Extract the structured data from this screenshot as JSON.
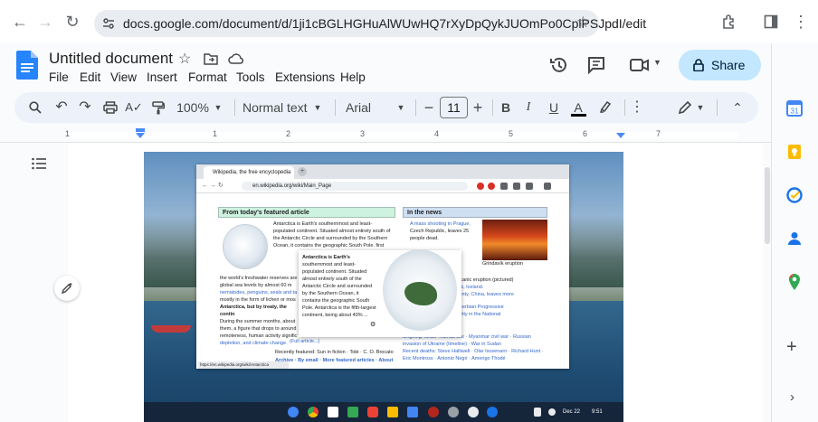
{
  "browser": {
    "url": "docs.google.com/document/d/1ji1cBGLHGHuAlWUwHQ7rXyDpQykJUOmPo0CplPSJpdI/edit"
  },
  "doc": {
    "title": "Untitled document",
    "menu": [
      "File",
      "Edit",
      "View",
      "Insert",
      "Format",
      "Tools",
      "Extensions",
      "Help"
    ],
    "share_label": "Share"
  },
  "toolbar": {
    "zoom": "100%",
    "style": "Normal text",
    "font": "Arial",
    "font_size": "11"
  },
  "ruler": {
    "labels": [
      "1",
      "1",
      "2",
      "3",
      "4",
      "5",
      "6",
      "7"
    ]
  },
  "embedded_screenshot": {
    "tab_title": "Wikipedia, the free encyclopedia",
    "address": "en.wikipedia.org/wiki/Main_Page",
    "featured_heading": "From today's featured article",
    "news_heading": "In the news",
    "featured_lines": [
      "Antarctica is Earth's southernmost and least-",
      "populated continent. Situated almost entirely south of",
      "the Antarctic Circle and surrounded by the Southern",
      "Ocean, it contains the geographic South Pole. first"
    ],
    "featured_lower_lines": [
      "the world's freshwater reserves are",
      "global sea levels by almost 60 m",
      "nematodes, penguins, seals and ta",
      "mostly in the form of lichen or mos",
      "Antarctica, but by treaty, the contin",
      "During the summer months, about",
      "them, a figure that drops to around",
      "remoteness, human activity signific",
      "depletion, and climate change."
    ],
    "full_article": "(Full article...)",
    "recently_featured": "Recently featured: Sun in fiction · Tobi · C. O. Brocato",
    "archive_line": "Archive · By email · More featured articles · About",
    "news_lines": [
      "A mass shooting in Prague,",
      "Czech Republic, leaves 25",
      "people dead."
    ],
    "volcano_caption": "Grindavík eruption",
    "news_lower_lines": [
      "quakes, a volcanic eruption (pictured)",
      "near Grindavík, Iceland.",
      "Jishishan County, China, leaves more",
      "election, the Serbian Progressive",
      "mentary majority in the National"
    ],
    "ongoing_line": "Ongoing: Israel–Hamas war · Myanmar civil war · Russian",
    "ongoing_line2": "invasion of Ukraine (timeline) · War in Sudan",
    "recent_deaths": "Recent deaths: Steve Halliwell · Olar Isosenarn · Richard Hunt ·",
    "recent_deaths2": "Eric Montross · Antonio Negri · Amerigo Thodé",
    "popup_lines": [
      "Antarctica is Earth's",
      "southernmost and least-",
      "populated continent. Situated",
      "almost entirely south of the",
      "Antarctic Circle and surrounded",
      "by the Southern Ocean, it",
      "contains the geographic South",
      "Pole. Antarctica is the fifth-largest",
      "continent, being about 40% ..."
    ],
    "status_url": "https://en.wikipedia.org/wiki/Antarctica",
    "shelf_date": "Dec 22",
    "shelf_time": "9:51"
  }
}
